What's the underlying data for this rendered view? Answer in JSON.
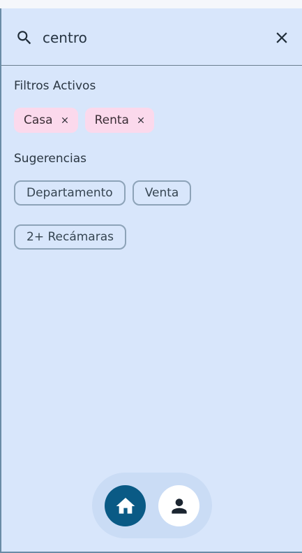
{
  "search": {
    "value": "centro",
    "icon": "search-icon",
    "clear_icon": "close-icon"
  },
  "active_filters": {
    "title": "Filtros Activos",
    "chips": [
      {
        "label": "Casa"
      },
      {
        "label": "Renta"
      }
    ]
  },
  "suggestions": {
    "title": "Sugerencias",
    "chips": [
      {
        "label": "Departamento"
      },
      {
        "label": "Venta"
      },
      {
        "label": "2+ Recámaras"
      }
    ]
  },
  "bottom_nav": {
    "items": [
      {
        "icon": "home-icon",
        "active": true
      },
      {
        "icon": "person-icon",
        "active": false
      }
    ]
  },
  "colors": {
    "panel_bg": "#d8e6fb",
    "active_chip_bg": "#fbd9ec",
    "nav_active": "#0a5a85",
    "nav_bar_bg": "#cadcf5"
  }
}
